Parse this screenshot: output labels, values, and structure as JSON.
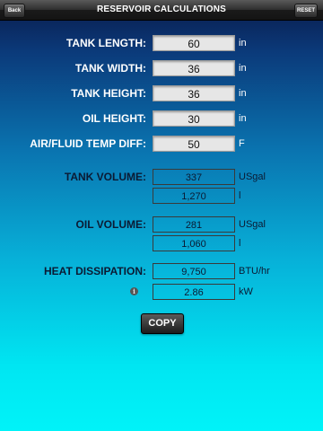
{
  "header": {
    "title": "RESERVOIR CALCULATIONS",
    "back_label": "Back",
    "reset_label": "RESET"
  },
  "inputs": [
    {
      "label": "TANK LENGTH:",
      "value": "60",
      "unit": "in"
    },
    {
      "label": "TANK WIDTH:",
      "value": "36",
      "unit": "in"
    },
    {
      "label": "TANK HEIGHT:",
      "value": "36",
      "unit": "in"
    },
    {
      "label": "OIL HEIGHT:",
      "value": "30",
      "unit": "in"
    },
    {
      "label": "AIR/FLUID TEMP DIFF:",
      "value": "50",
      "unit": "F"
    }
  ],
  "results": {
    "tank_volume": {
      "label": "TANK VOLUME:",
      "value1": "337",
      "unit1": "USgal",
      "value2": "1,270",
      "unit2": "l"
    },
    "oil_volume": {
      "label": "OIL VOLUME:",
      "value1": "281",
      "unit1": "USgal",
      "value2": "1,060",
      "unit2": "l"
    },
    "heat_dissipation": {
      "label": "HEAT DISSIPATION:",
      "value1": "9,750",
      "unit1": "BTU/hr",
      "value2": "2.86",
      "unit2": "kW"
    }
  },
  "info_icon": "info-icon",
  "copy_label": "COPY"
}
